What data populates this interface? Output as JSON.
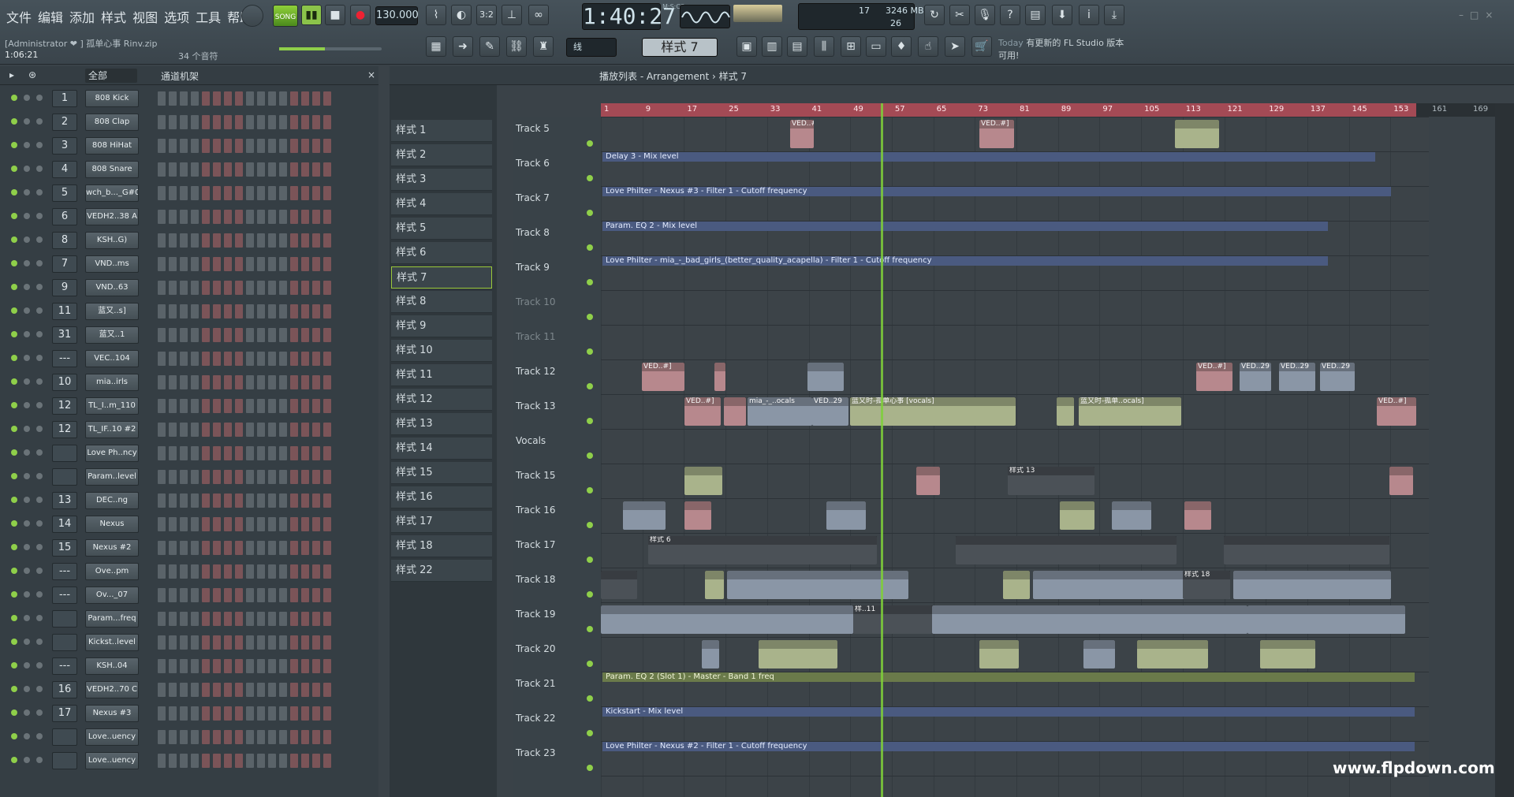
{
  "menu": [
    "文件",
    "编辑",
    "添加",
    "样式",
    "视图",
    "选项",
    "工具",
    "帮助"
  ],
  "transport": {
    "mode": "SONG",
    "tempo": "130.000",
    "time": "1:40:27",
    "time_unit": "M:S:CS",
    "pattern": "样式 7",
    "snap": "线",
    "cpu": "17",
    "memory": "3246 MB",
    "voices": "26"
  },
  "info": {
    "user": "[Administrator ❤",
    "project": "] 孤单心事 Rinv.zip",
    "time": "1:06:21",
    "voices": "34 个音符"
  },
  "news": {
    "today": "Today",
    "text": "有更新的 FL Studio 版本可用!"
  },
  "rack": {
    "filter": "全部",
    "title": "通道机架",
    "channels": [
      {
        "num": "1",
        "name": "808 Kick"
      },
      {
        "num": "2",
        "name": "808 Clap"
      },
      {
        "num": "3",
        "name": "808 HiHat"
      },
      {
        "num": "4",
        "name": "808 Snare"
      },
      {
        "num": "5",
        "name": "wch_b..._G#0"
      },
      {
        "num": "6",
        "name": "VEDH2..38 A"
      },
      {
        "num": "8",
        "name": "KSH..G)"
      },
      {
        "num": "7",
        "name": "VND..ms"
      },
      {
        "num": "9",
        "name": "VND..63"
      },
      {
        "num": "11",
        "name": "蓝又..s]"
      },
      {
        "num": "31",
        "name": "蓝又..1"
      },
      {
        "num": "---",
        "name": "VEC..104"
      },
      {
        "num": "10",
        "name": "mia..irls"
      },
      {
        "num": "12",
        "name": "TL_I..m_110"
      },
      {
        "num": "12",
        "name": "TL_IF..10 #2"
      },
      {
        "num": "",
        "name": "Love Ph..ncy"
      },
      {
        "num": "",
        "name": "Param..level"
      },
      {
        "num": "13",
        "name": "DEC..ng"
      },
      {
        "num": "14",
        "name": "Nexus"
      },
      {
        "num": "15",
        "name": "Nexus #2"
      },
      {
        "num": "---",
        "name": "Ove..pm"
      },
      {
        "num": "---",
        "name": "Ov..._07"
      },
      {
        "num": "",
        "name": "Param...freq"
      },
      {
        "num": "",
        "name": "Kickst..level"
      },
      {
        "num": "---",
        "name": "KSH..04"
      },
      {
        "num": "16",
        "name": "VEDH2..70 C"
      },
      {
        "num": "17",
        "name": "Nexus #3"
      },
      {
        "num": "",
        "name": "Love..uency"
      },
      {
        "num": "",
        "name": "Love..uency"
      }
    ]
  },
  "patterns": [
    "样式 1",
    "样式 2",
    "样式 3",
    "样式 4",
    "样式 5",
    "样式 6",
    "样式 7",
    "样式 8",
    "样式 9",
    "样式 10",
    "样式 11",
    "样式 12",
    "样式 13",
    "样式 14",
    "样式 15",
    "样式 16",
    "样式 17",
    "样式 18",
    "样式 22"
  ],
  "playlist": {
    "title": "播放列表 - Arrangement › 样式 7",
    "ruler": [
      "1",
      "9",
      "17",
      "25",
      "33",
      "41",
      "49",
      "57",
      "65",
      "73",
      "81",
      "89",
      "97",
      "105",
      "113",
      "121",
      "129",
      "137",
      "145",
      "153"
    ],
    "ruler_out": [
      "161",
      "169"
    ],
    "tracks": [
      "Track 5",
      "Track 6",
      "Track 7",
      "Track 8",
      "Track 9",
      "Track 10",
      "Track 11",
      "Track 12",
      "Track 13",
      "Vocals",
      "Track 15",
      "Track 16",
      "Track 17",
      "Track 18",
      "Track 19",
      "Track 20",
      "Track 21",
      "Track 22",
      "Track 23"
    ],
    "automation": [
      {
        "text": "Delay 3 - Mix level"
      },
      {
        "text": "Love Philter - Nexus #3 - Filter 1 - Cutoff frequency"
      },
      {
        "text": "Param. EQ 2 - Mix level"
      },
      {
        "text": "Love Philter - mia_-_bad_girls_(better_quality_acapella) - Filter 1 - Cutoff frequency"
      },
      {
        "text": "Param. EQ 2 (Slot 1) - Master - Band 1 freq"
      },
      {
        "text": "Kickstart - Mix level"
      },
      {
        "text": "Love Philter - Nexus #2 - Filter 1 - Cutoff frequency"
      }
    ],
    "clips": {
      "vocal1": "蓝又时-孤单心事 [vocals]",
      "vocal2": "蓝又时-孤单..ocals]",
      "mia": "mia_-_..ocals",
      "ved": "VED..#]",
      "ved29": "VED..29",
      "pat13": "样式 13",
      "pat18": "样式 18",
      "pat6": "样式 6",
      "pat11": "样..11"
    }
  },
  "watermark": "www.flpdown.com"
}
